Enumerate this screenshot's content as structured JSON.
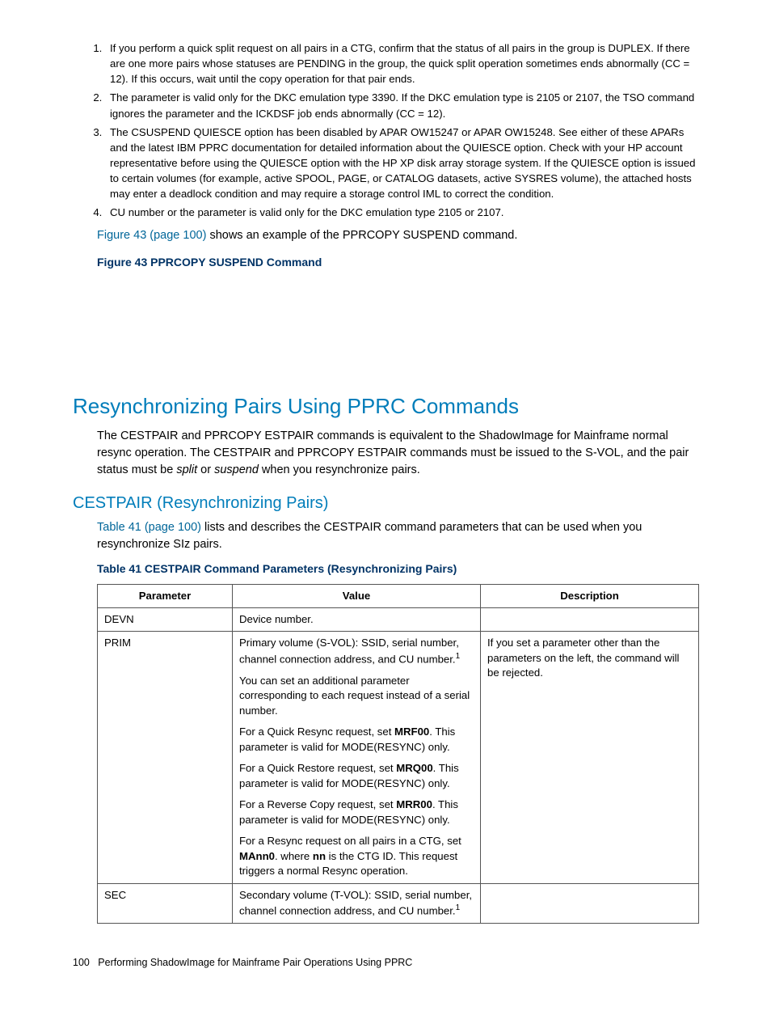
{
  "notes": [
    "If you perform a quick split request on all pairs in a CTG, confirm that the status of all pairs in the group is DUPLEX. If there are one more pairs whose statuses are PENDING in the group, the quick split operation sometimes ends abnormally (CC = 12). If this occurs, wait until the copy operation for that pair ends.",
    "The parameter is valid only for the DKC emulation type 3390. If the DKC emulation type is 2105 or 2107, the TSO command ignores the parameter and the ICKDSF job ends abnormally (CC = 12).",
    "The CSUSPEND QUIESCE option has been disabled by APAR OW15247 or APAR OW15248. See either of these APARs and the latest IBM PPRC documentation for detailed information about the QUIESCE option. Check with your HP account representative before using the QUIESCE option with the HP XP disk array storage system. If the QUIESCE option is issued to certain volumes (for example, active SPOOL, PAGE, or CATALOG datasets, active SYSRES volume), the attached hosts may enter a deadlock condition and may require a storage control IML to correct the condition.",
    "CU number or the parameter is valid only for the DKC emulation type 2105 or 2107."
  ],
  "fig_ref_link": "Figure 43 (page 100)",
  "fig_ref_tail": " shows an example of the PPRCOPY SUSPEND command.",
  "fig_title": "Figure 43 PPRCOPY SUSPEND Command",
  "section_title": "Resynchronizing Pairs Using PPRC Commands",
  "section_para_a": "The CESTPAIR and PPRCOPY ESTPAIR commands is equivalent to the ShadowImage for Mainframe normal resync operation. The CESTPAIR and PPRCOPY ESTPAIR commands must be issued to the S-VOL, and the pair status must be ",
  "section_para_b": "split",
  "section_para_c": " or ",
  "section_para_d": "suspend",
  "section_para_e": " when you resynchronize pairs.",
  "subsection_title": "CESTPAIR (Resynchronizing Pairs)",
  "sub_ref_link": "Table 41 (page 100)",
  "sub_ref_tail": " lists and describes the CESTPAIR command parameters that can be used when you resynchronize SIz pairs.",
  "table_title": "Table 41 CESTPAIR Command Parameters (Resynchronizing Pairs)",
  "headers": {
    "p": "Parameter",
    "v": "Value",
    "d": "Description"
  },
  "rows": {
    "devn": {
      "param": "DEVN",
      "value": "Device number.",
      "desc": ""
    },
    "prim": {
      "param": "PRIM",
      "v1a": "Primary volume (S-VOL): SSID, serial number, channel connection address, and CU number.",
      "v1s": "1",
      "v2": "You can set an additional parameter corresponding to each request instead of a serial number.",
      "v3a": "For a Quick Resync request, set ",
      "v3b": "MRF00",
      "v3c": ". This parameter is valid for MODE(RESYNC) only.",
      "v4a": "For a Quick Restore request, set ",
      "v4b": "MRQ00",
      "v4c": ". This parameter is valid for MODE(RESYNC) only.",
      "v5a": "For a Reverse Copy request, set ",
      "v5b": "MRR00",
      "v5c": ". This parameter is valid for MODE(RESYNC) only.",
      "v6a": "For a Resync request on all pairs in a CTG, set ",
      "v6b": "MAnn0",
      "v6c": ". where ",
      "v6d": "nn",
      "v6e": " is the CTG ID. This request triggers a normal Resync operation.",
      "desc": "If you set a parameter other than the parameters on the left, the command will be rejected."
    },
    "sec": {
      "param": "SEC",
      "v1": "Secondary volume (T-VOL): SSID, serial number, channel connection address, and CU number.",
      "v1s": "1",
      "desc": ""
    }
  },
  "footer_page": "100",
  "footer_text": "Performing ShadowImage for Mainframe Pair Operations Using PPRC"
}
